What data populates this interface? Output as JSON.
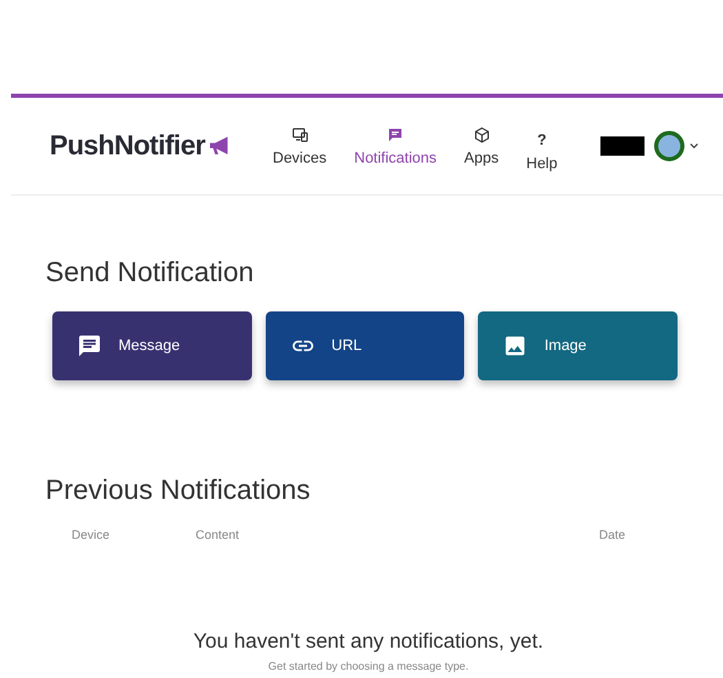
{
  "header": {
    "logo": "PushNotifier",
    "nav": [
      {
        "label": "Devices",
        "kind": "devices",
        "selected": false
      },
      {
        "label": "Notifications",
        "kind": "notifications",
        "selected": true
      },
      {
        "label": "Apps",
        "kind": "apps",
        "selected": false
      },
      {
        "label": "Help",
        "kind": "help",
        "icon": "?",
        "selected": false
      }
    ]
  },
  "send": {
    "title": "Send Notification",
    "buttons": [
      {
        "label": "Message",
        "kind": "message",
        "color": "#383170"
      },
      {
        "label": "URL",
        "kind": "url",
        "color": "#134487"
      },
      {
        "label": "Image",
        "kind": "image",
        "color": "#136882"
      }
    ]
  },
  "previous": {
    "title": "Previous Notifications",
    "columns": [
      "Device",
      "Content",
      "Date"
    ],
    "empty_title": "You haven't sent any notifications, yet.",
    "empty_hint": "Get started by choosing a message type."
  }
}
